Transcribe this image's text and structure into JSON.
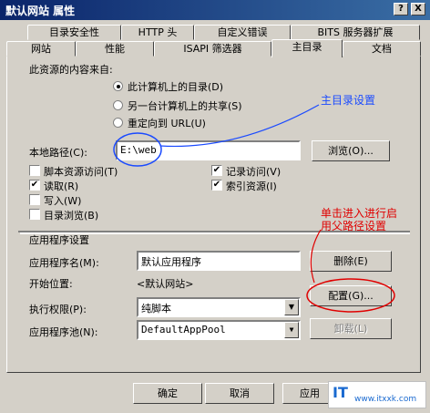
{
  "window": {
    "title": "默认网站 属性",
    "help": "?",
    "close": "X"
  },
  "tabs_row1": [
    "目录安全性",
    "HTTP 头",
    "自定义错误",
    "BITS 服务器扩展"
  ],
  "tabs_row2": [
    "网站",
    "性能",
    "ISAPI 筛选器",
    "主目录",
    "文档"
  ],
  "source": {
    "heading": "此资源的内容来自:",
    "options": [
      "此计算机上的目录(D)",
      "另一台计算机上的共享(S)",
      "重定向到 URL(U)"
    ],
    "selected": 0
  },
  "local_path": {
    "label": "本地路径(C):",
    "value": "E:\\web",
    "browse": "浏览(O)..."
  },
  "checks_left": [
    {
      "label": "脚本资源访问(T)",
      "checked": false
    },
    {
      "label": "读取(R)",
      "checked": true
    },
    {
      "label": "写入(W)",
      "checked": false
    },
    {
      "label": "目录浏览(B)",
      "checked": false
    }
  ],
  "checks_right": [
    {
      "label": "记录访问(V)",
      "checked": true
    },
    {
      "label": "索引资源(I)",
      "checked": true
    }
  ],
  "app_settings": {
    "heading": "应用程序设置",
    "name_label": "应用程序名(M):",
    "name_value": "默认应用程序",
    "remove": "删除(E)",
    "start_label": "开始位置:",
    "start_value": "<默认网站>",
    "config": "配置(G)...",
    "perm_label": "执行权限(P):",
    "perm_value": "纯脚本",
    "pool_label": "应用程序池(N):",
    "pool_value": "DefaultAppPool",
    "unload": "卸载(L)"
  },
  "footer": {
    "ok": "确定",
    "cancel": "取消",
    "apply": "应用"
  },
  "annotations": {
    "main_dir": "主目录设置",
    "parent_path_line1": "单击进入进行启",
    "parent_path_line2": "用父路径设置",
    "watermark": "www.itxxk.com"
  }
}
